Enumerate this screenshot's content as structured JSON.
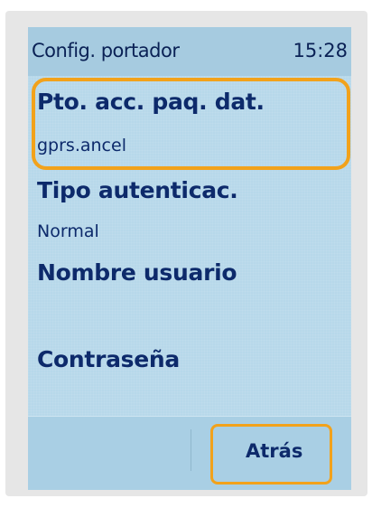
{
  "header": {
    "title": "Config. portador",
    "time": "15:28"
  },
  "fields": [
    {
      "label": "Pto. acc. paq. dat.",
      "value": "gprs.ancel"
    },
    {
      "label": "Tipo autenticac.",
      "value": "Normal"
    },
    {
      "label": "Nombre usuario",
      "value": ""
    },
    {
      "label": "Contraseña",
      "value": ""
    }
  ],
  "softkeys": {
    "back_label": "Atrás"
  },
  "colors": {
    "screen_background": "#b7d8ea",
    "text": "#0d2a6b",
    "highlight": "#f2a21b"
  }
}
